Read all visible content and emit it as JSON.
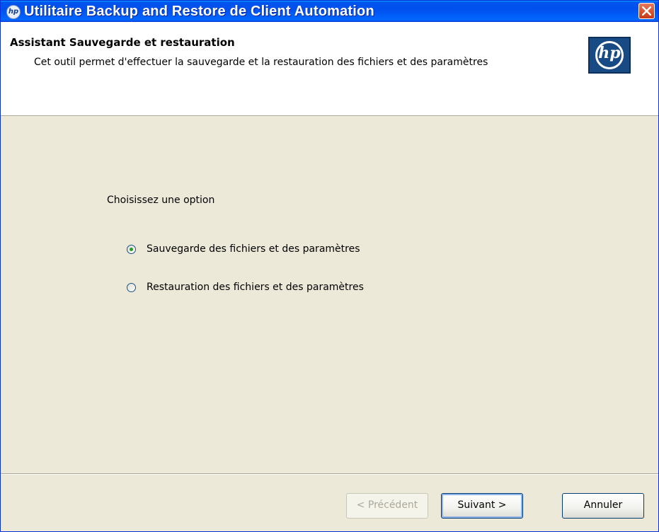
{
  "window": {
    "title": "Utilitaire Backup and Restore de Client Automation",
    "app_icon_text": "hp"
  },
  "header": {
    "title": "Assistant Sauvegarde et restauration",
    "subtitle": "Cet outil permet d'effectuer la sauvegarde et la restauration des fichiers et des paramètres",
    "logo_text": "hp"
  },
  "main": {
    "prompt": "Choisissez une option",
    "options": [
      {
        "label": "Sauvegarde des fichiers et des paramètres",
        "selected": true
      },
      {
        "label": "Restauration des fichiers et des paramètres",
        "selected": false
      }
    ]
  },
  "buttons": {
    "previous": "< Précédent",
    "next": "Suivant >",
    "cancel": "Annuler"
  },
  "colors": {
    "titlebar": "#0050ee",
    "panel": "#ece9d8",
    "hp_blue": "#184b83"
  }
}
